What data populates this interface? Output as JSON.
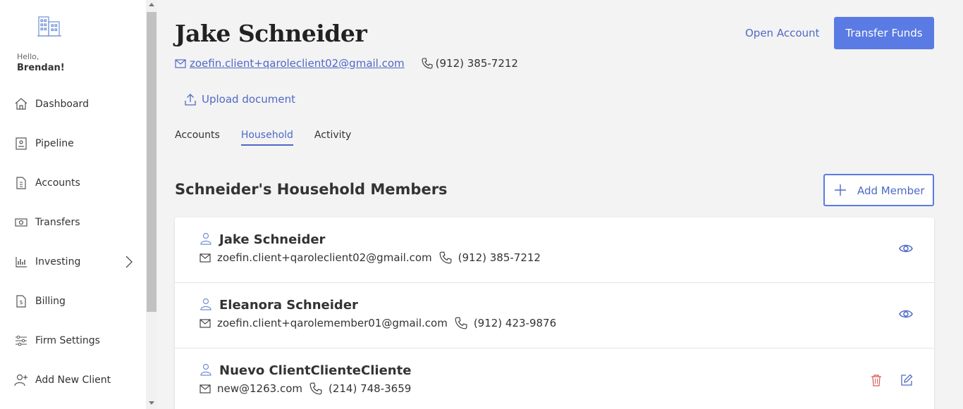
{
  "sidebar": {
    "greeting": "Hello,",
    "user_name": "Brendan!",
    "items": [
      {
        "label": "Dashboard",
        "icon": "home-icon"
      },
      {
        "label": "Pipeline",
        "icon": "pipeline-icon"
      },
      {
        "label": "Accounts",
        "icon": "accounts-icon"
      },
      {
        "label": "Transfers",
        "icon": "transfers-icon"
      },
      {
        "label": "Investing",
        "icon": "investing-icon"
      },
      {
        "label": "Billing",
        "icon": "billing-icon"
      },
      {
        "label": "Firm Settings",
        "icon": "settings-sliders-icon"
      },
      {
        "label": "Add New Client",
        "icon": "add-user-icon"
      }
    ]
  },
  "header": {
    "client_name": "Jake Schneider",
    "email": "zoefin.client+qaroleclient02@gmail.com",
    "phone": "(912) 385-7212",
    "upload_label": "Upload document",
    "open_account_label": "Open Account",
    "transfer_funds_label": "Transfer Funds"
  },
  "tabs": [
    {
      "label": "Accounts",
      "active": false
    },
    {
      "label": "Household",
      "active": true
    },
    {
      "label": "Activity",
      "active": false
    }
  ],
  "household": {
    "title": "Schneider's Household Members",
    "add_member_label": "Add Member",
    "members": [
      {
        "name": "Jake Schneider",
        "email": "zoefin.client+qaroleclient02@gmail.com",
        "phone": "(912) 385-7212",
        "actions": [
          "view"
        ]
      },
      {
        "name": "Eleanora Schneider",
        "email": "zoefin.client+qarolemember01@gmail.com",
        "phone": "(912) 423-9876",
        "actions": [
          "view"
        ]
      },
      {
        "name": "Nuevo ClientClienteCliente",
        "email": "new@1263.com",
        "phone": "(214) 748-3659",
        "actions": [
          "delete",
          "edit"
        ]
      }
    ]
  },
  "colors": {
    "accent": "#5a7be3",
    "link": "#4e69c8",
    "danger": "#e05656",
    "background": "#f3f3f3"
  }
}
